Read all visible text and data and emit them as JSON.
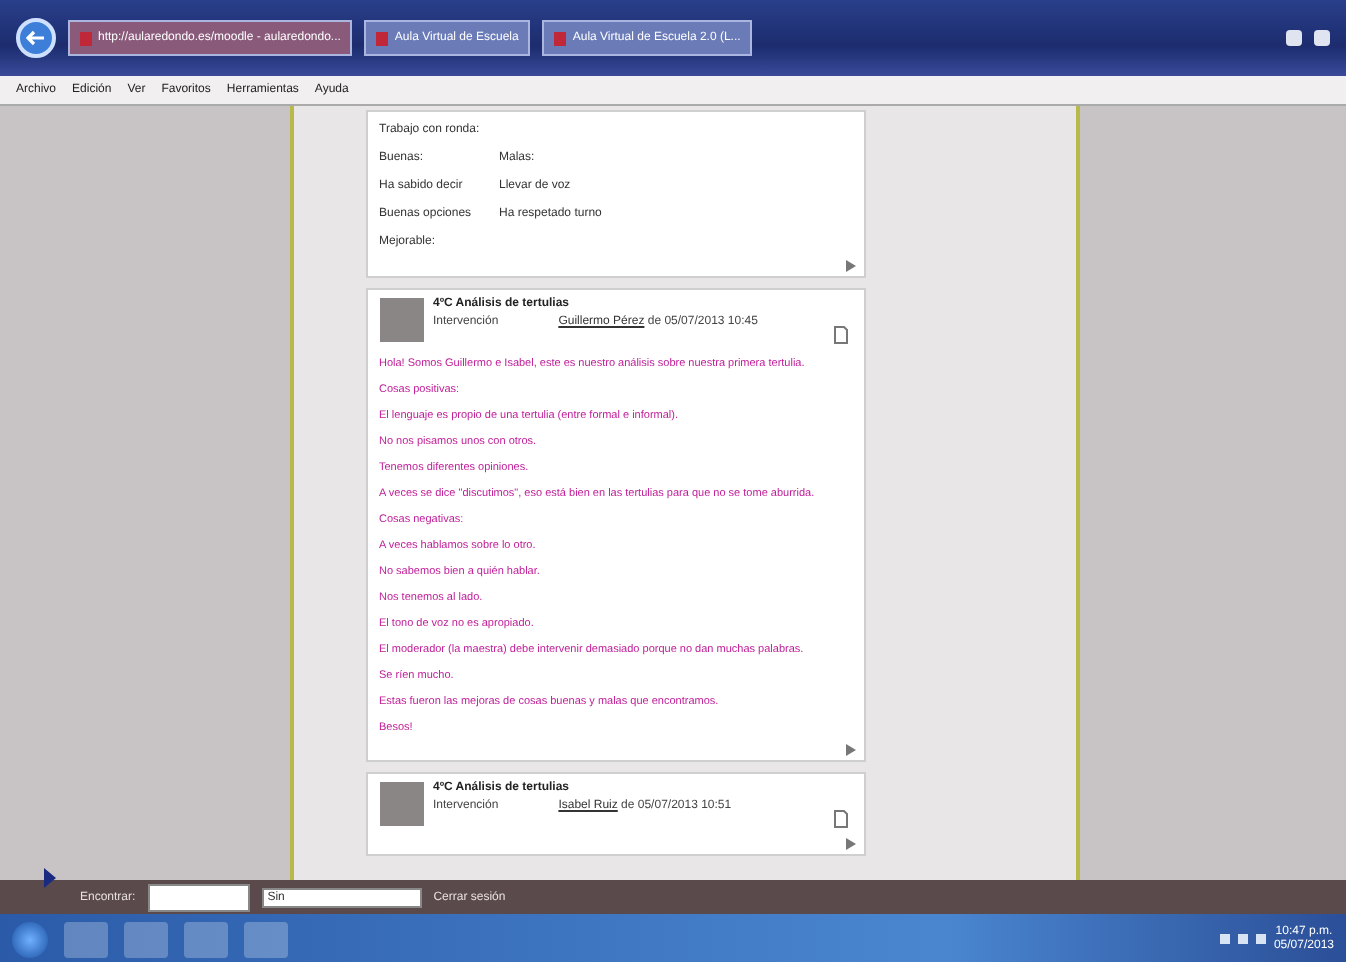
{
  "browser": {
    "tabs": [
      {
        "title": "http://aularedondo.es/moodle - aularedondo...",
        "selected": true
      },
      {
        "title": "Aula Virtual de Escuela",
        "selected": false
      },
      {
        "title": "Aula Virtual de Escuela 2.0 (L...",
        "selected": false
      }
    ],
    "menu": [
      "Archivo",
      "Edición",
      "Ver",
      "Favoritos",
      "Herramientas",
      "Ayuda"
    ]
  },
  "posts": [
    {
      "kind": "plain",
      "rows": [
        [
          "Trabajo con ronda:"
        ],
        [
          "Buenas:",
          "Malas:"
        ],
        [
          "Ha sabido decir",
          "Llevar de voz"
        ],
        [
          "Buenas opciones",
          "Ha respetado turno"
        ],
        [
          "Mejorable:"
        ]
      ]
    },
    {
      "kind": "reply",
      "title": "4ºC Análisis de tertulias",
      "subtitle": "Intervención",
      "author": "Guillermo Pérez",
      "date": "de 05/07/2013 10:45",
      "lines": [
        "Hola! Somos Guillermo e Isabel, este es nuestro análisis sobre nuestra primera tertulia.",
        "Cosas positivas:",
        "El lenguaje es propio de una tertulia (entre formal e informal).",
        "No nos pisamos unos con otros.",
        "Tenemos diferentes opiniones.",
        "A veces se dice \"discutimos\", eso está bien en las tertulias para que no se tome aburrida.",
        "Cosas negativas:",
        "A veces hablamos sobre lo otro.",
        "No sabemos bien a quién hablar.",
        "Nos tenemos al lado.",
        "El tono de voz no es apropiado.",
        "El moderador (la maestra) debe intervenir demasiado porque no dan muchas palabras.",
        "Se ríen mucho.",
        "Estas fueron las mejoras de cosas buenas y malas que encontramos.",
        "Besos!"
      ]
    },
    {
      "kind": "reply",
      "title": "4ºC Análisis de tertulias",
      "subtitle": "Intervención",
      "author": "Isabel Ruiz",
      "date": "de 05/07/2013 10:51"
    }
  ],
  "find_bar": {
    "label": "Encontrar:",
    "option": "Sin",
    "close": "Cerrar sesión"
  },
  "taskbar": {
    "time": "10:47 p.m.",
    "date": "05/07/2013"
  }
}
